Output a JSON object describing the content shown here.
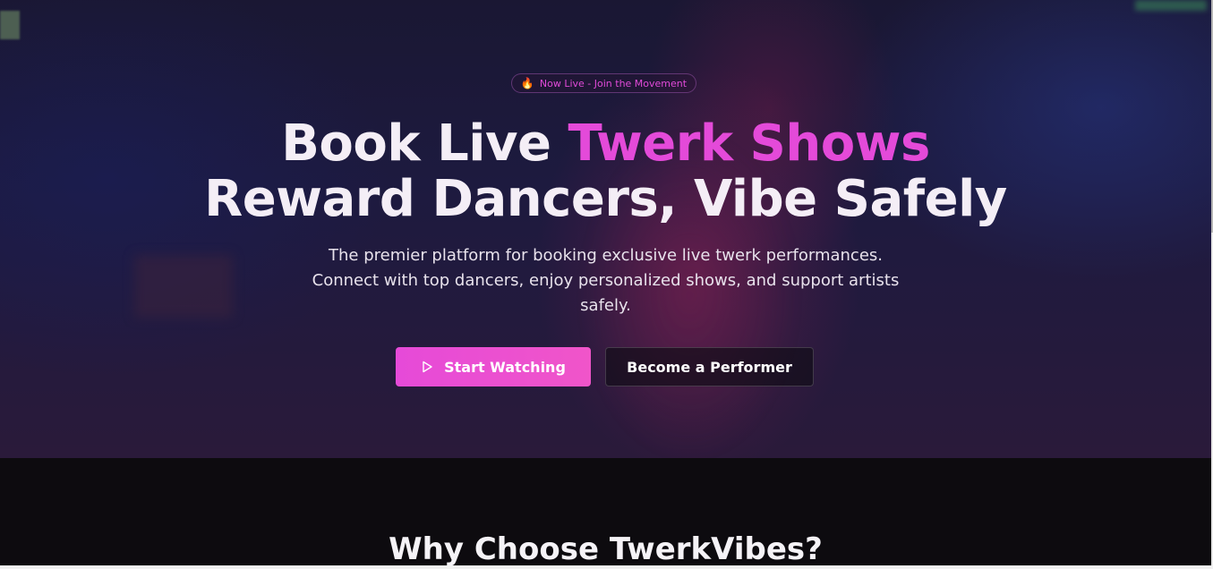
{
  "hero": {
    "badge_icon": "flame-icon",
    "badge_text": "Now Live - Join the Movement",
    "headline_line1_prefix": "Book Live ",
    "headline_line1_accent": "Twerk Shows",
    "headline_line2": "Reward Dancers, Vibe Safely",
    "subtext": "The premier platform for booking exclusive live twerk performances. Connect with top dancers, enjoy personalized shows, and support artists safely.",
    "primary_button": {
      "icon": "play-icon",
      "label": "Start Watching"
    },
    "secondary_button": {
      "label": "Become a Performer"
    }
  },
  "features": {
    "title": "Why Choose TwerkVibes?"
  },
  "colors": {
    "accent": "#e44ad9",
    "badge_text": "#e04ad8",
    "primary_button": "#e64ad8",
    "background_dark": "#0d0b0f"
  }
}
